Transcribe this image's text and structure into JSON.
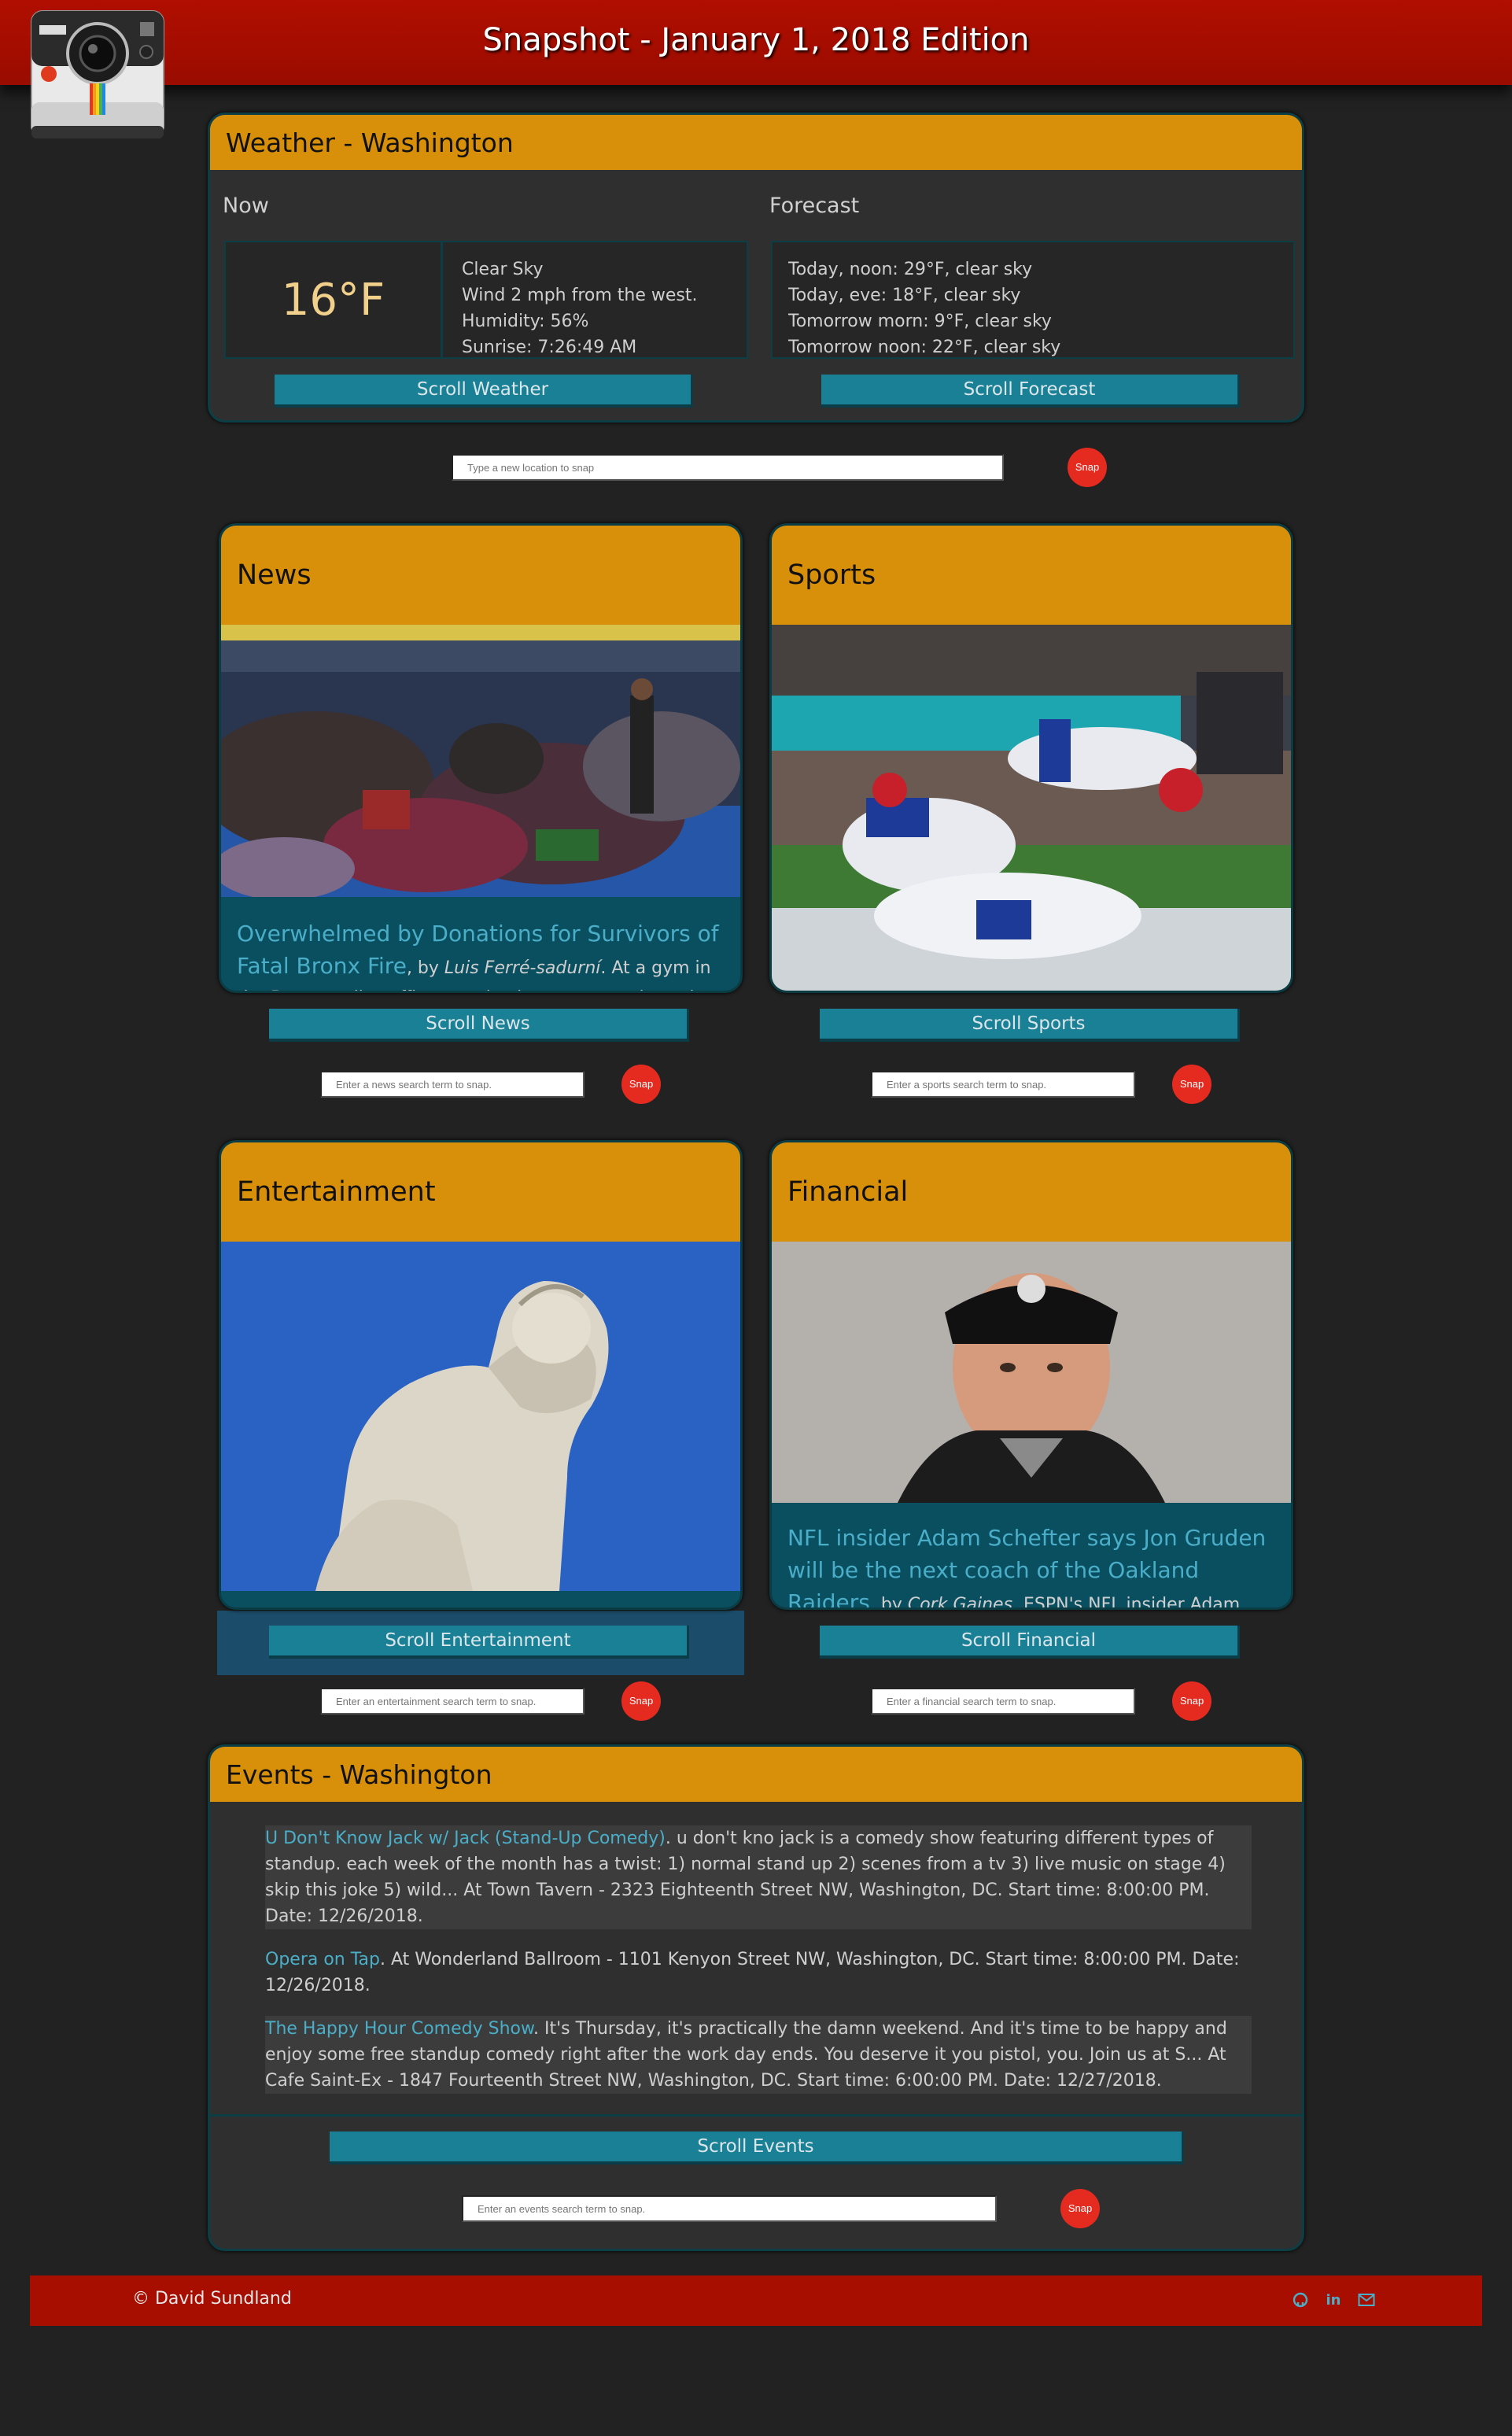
{
  "header": {
    "title": "Snapshot - January 1, 2018 Edition",
    "logo_icon": "instant-camera-icon"
  },
  "weather": {
    "title": "Weather - Washington",
    "now_label": "Now",
    "forecast_label": "Forecast",
    "temperature": "16°F",
    "conditions": [
      "Clear Sky",
      "Wind 2 mph from the west.",
      "Humidity: 56%",
      "Sunrise: 7:26:49 AM"
    ],
    "forecast": [
      "Today, noon: 29°F, clear sky",
      "Today, eve: 18°F, clear sky",
      "Tomorrow morn: 9°F, clear sky",
      "Tomorrow noon: 22°F, clear sky"
    ],
    "scroll_weather": "Scroll Weather",
    "scroll_forecast": "Scroll Forecast"
  },
  "location_search": {
    "placeholder": "Type a new location to snap",
    "snap": "Snap"
  },
  "news": {
    "title": "News",
    "headline": "Overwhelmed by Donations for Survivors of Fatal Bronx Fire",
    "by": ", by ",
    "author": "Luis Ferré-sadurní",
    "snippet": ". At a gym in the Bronx, police officers and volunteers sort through",
    "scroll": "Scroll News",
    "search_placeholder": "Enter a news search term to snap.",
    "snap": "Snap"
  },
  "sports": {
    "title": "Sports",
    "scroll": "Scroll Sports",
    "search_placeholder": "Enter a sports search term to snap.",
    "snap": "Snap"
  },
  "entertainment": {
    "title": "Entertainment",
    "scroll": "Scroll Entertainment",
    "search_placeholder": "Enter an entertainment search term to snap.",
    "snap": "Snap"
  },
  "financial": {
    "title": "Financial",
    "headline": "NFL insider Adam Schefter says Jon Gruden will be the next coach of the Oakland Raiders",
    "by": ", by ",
    "author": "Cork Gaines",
    "snippet": ". ESPN's NFL insider Adam Schefter says",
    "scroll": "Scroll Financial",
    "search_placeholder": "Enter a financial search term to snap.",
    "snap": "Snap"
  },
  "events": {
    "title": "Events - Washington",
    "items": [
      {
        "title": "U Don't Know Jack w/ Jack (Stand-Up Comedy)",
        "text": ". u don't kno jack is a comedy show featuring different types of standup. each week of the month has a twist: 1) normal stand up 2) scenes from a tv 3) live music on stage 4) skip this joke 5) wild... At Town Tavern - 2323 Eighteenth Street NW, Washington, DC. Start time: 8:00:00 PM. Date: 12/26/2018."
      },
      {
        "title": "Opera on Tap",
        "text": ". At Wonderland Ballroom - 1101 Kenyon Street NW, Washington, DC. Start time: 8:00:00 PM. Date: 12/26/2018."
      },
      {
        "title": "The Happy Hour Comedy Show",
        "text": ". It's Thursday, it's practically the damn weekend. And it's time to be happy and enjoy some free standup comedy right after the work day ends. You deserve it you pistol, you.  Join us at S... At Cafe Saint-Ex - 1847 Fourteenth Street NW, Washington, DC. Start time: 6:00:00 PM. Date: 12/27/2018."
      }
    ],
    "scroll": "Scroll Events",
    "search_placeholder": "Enter an events search term to snap.",
    "snap": "Snap"
  },
  "footer": {
    "copyright": "© David Sundland",
    "icons": [
      "github-icon",
      "linkedin-icon",
      "email-icon"
    ]
  },
  "colors": {
    "header_red": "#a70e00",
    "panel_gold": "#d8900a",
    "button_teal": "#1a8096",
    "link_blue": "#4aaec8",
    "snap_red": "#e52b1f"
  }
}
